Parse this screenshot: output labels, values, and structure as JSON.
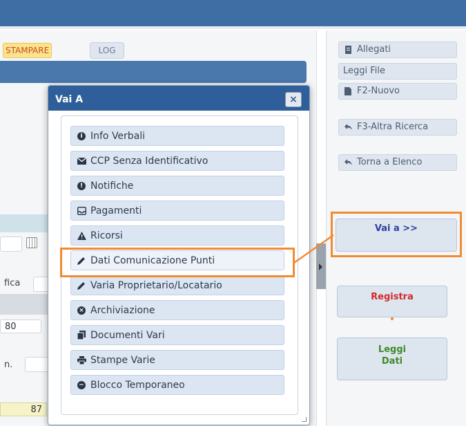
{
  "background_app": {
    "stampare_label": "STAMPARE",
    "log_label": "LOG",
    "fica_label": "fica",
    "field_80": "80",
    "m_label": "n.",
    "field_87": "87"
  },
  "right_panel": {
    "allegati": "Allegati",
    "leggi_file": "Leggi File",
    "f2_nuovo": "F2-Nuovo",
    "f3_altra_ricerca": "F3-Altra Ricerca",
    "torna_elenco": "Torna a Elenco",
    "vai_a": "Vai a >>",
    "registra": "Registra",
    "leggi_dati_line1": "Leggi",
    "leggi_dati_line2": "Dati"
  },
  "dialog": {
    "title": "Vai A",
    "close_label": "×",
    "items": [
      {
        "label": "Info Verbali",
        "icon": "info-icon"
      },
      {
        "label": "CCP Senza Identificativo",
        "icon": "envelope-icon"
      },
      {
        "label": "Notifiche",
        "icon": "exclamation-icon"
      },
      {
        "label": "Pagamenti",
        "icon": "inbox-icon"
      },
      {
        "label": "Ricorsi",
        "icon": "warning-icon"
      },
      {
        "label": "Dati Comunicazione Punti",
        "icon": "pencil-icon"
      },
      {
        "label": "Varia Proprietario/Locatario",
        "icon": "pencil-icon"
      },
      {
        "label": "Archiviazione",
        "icon": "close-circle-icon"
      },
      {
        "label": "Documenti Vari",
        "icon": "documents-icon"
      },
      {
        "label": "Stampe Varie",
        "icon": "print-icon"
      },
      {
        "label": "Blocco Temporaneo",
        "icon": "minus-circle-icon"
      }
    ]
  },
  "colors": {
    "accent_blue": "#2f5f9a",
    "highlight_orange": "#f28a30",
    "registra_red": "#d12a2a",
    "leggi_green": "#3f8a26",
    "vai_blue": "#2b3f9e"
  }
}
